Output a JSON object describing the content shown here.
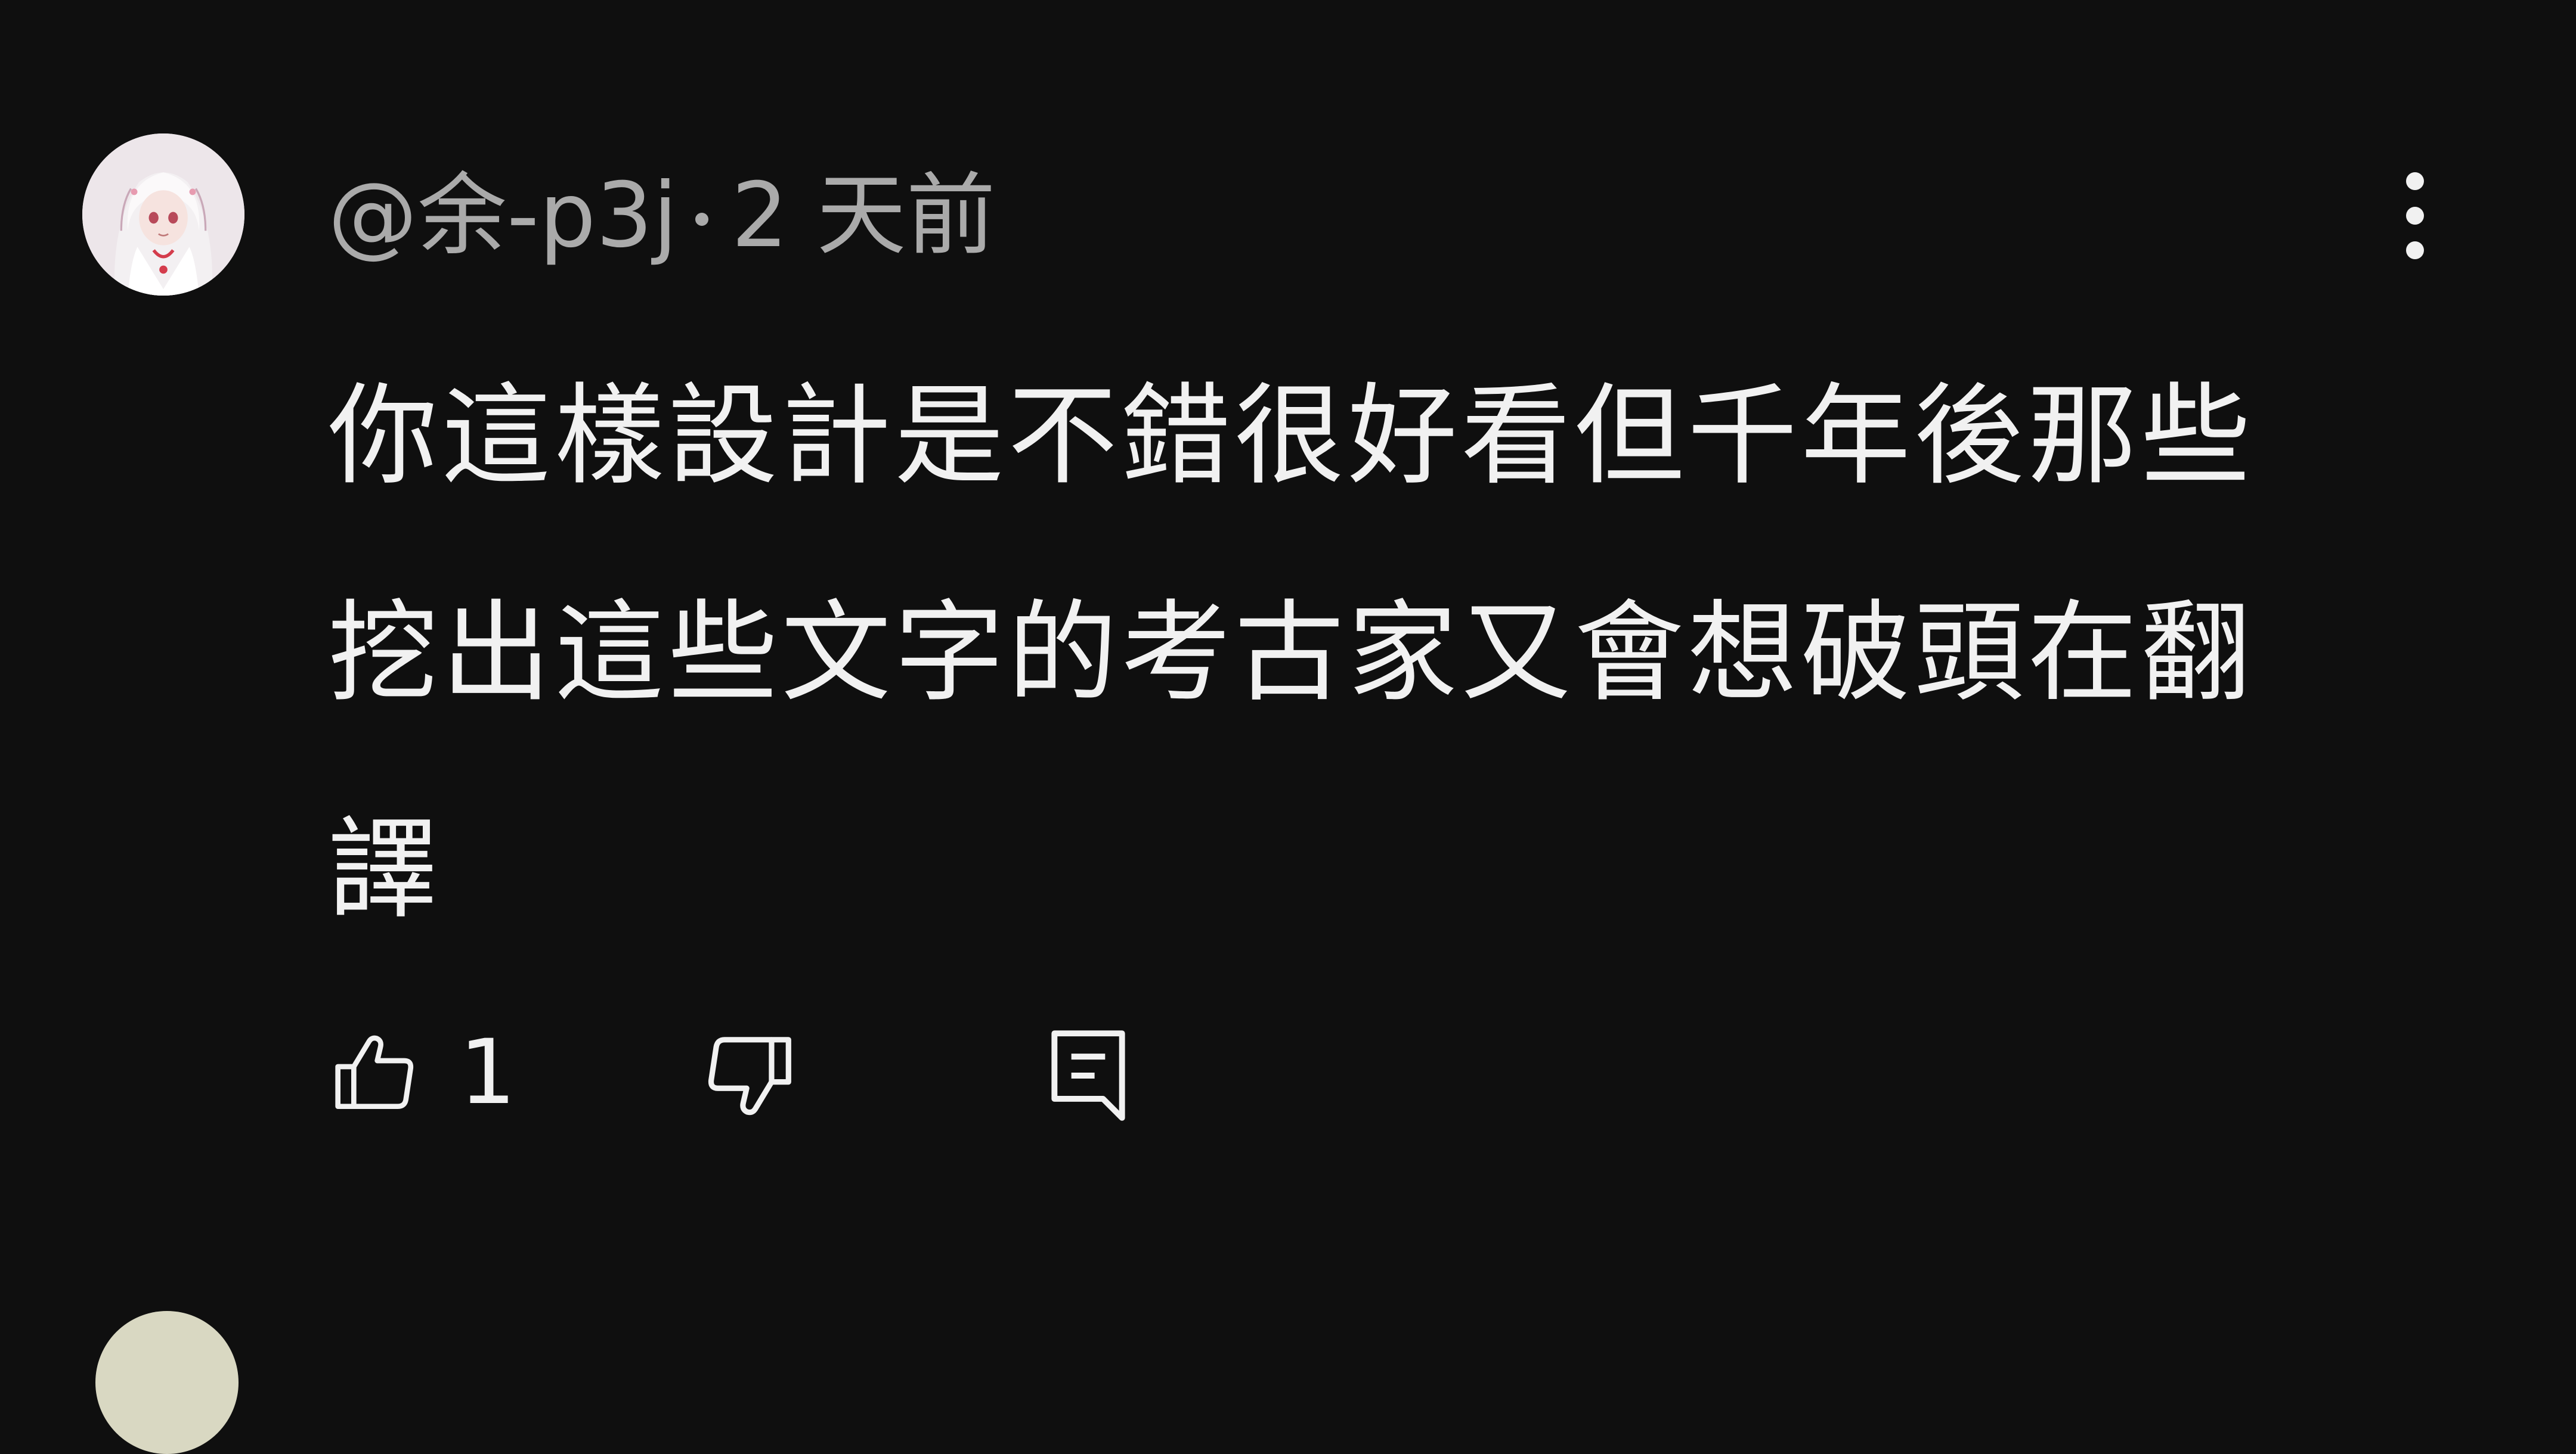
{
  "comment": {
    "author": "@余-p3j",
    "time": "2 天前",
    "text": "你這樣設計是不錯很好看但千年後那些挖出這些文字的考古家又會想破頭在翻譯",
    "like_count": "1",
    "icons": {
      "avatar": "anime-avatar",
      "more": "more-vert-icon",
      "like": "thumb-up-icon",
      "dislike": "thumb-down-icon",
      "reply": "reply-icon"
    }
  },
  "colors": {
    "background": "#0f0f0f",
    "text": "#f1f1f1",
    "secondary_text": "#aaaaaa"
  }
}
